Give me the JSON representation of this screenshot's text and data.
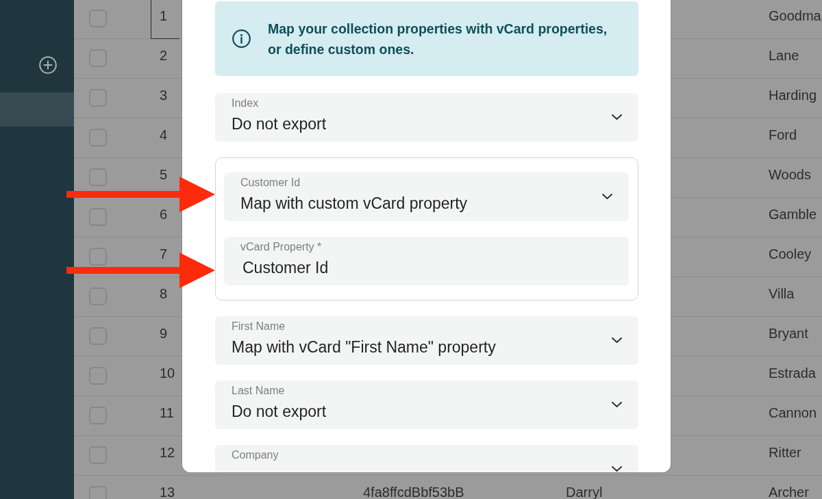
{
  "sidebar": {
    "items": [
      {
        "selected": true
      }
    ]
  },
  "table": {
    "rows": [
      {
        "checked": false,
        "focused": true,
        "number": "1",
        "column_5": "Goodma"
      },
      {
        "checked": false,
        "focused": false,
        "number": "2",
        "column_5": "Lane"
      },
      {
        "checked": false,
        "focused": false,
        "number": "3",
        "column_5": "Harding"
      },
      {
        "checked": false,
        "focused": false,
        "number": "4",
        "column_5": "Ford"
      },
      {
        "checked": false,
        "focused": false,
        "number": "5",
        "column_5": "Woods"
      },
      {
        "checked": false,
        "focused": false,
        "number": "6",
        "column_5": "Gamble"
      },
      {
        "checked": false,
        "focused": false,
        "number": "7",
        "column_5": "Cooley"
      },
      {
        "checked": false,
        "focused": false,
        "number": "8",
        "column_5": "Villa"
      },
      {
        "checked": false,
        "focused": false,
        "number": "9",
        "column_5": "Bryant"
      },
      {
        "checked": false,
        "focused": false,
        "number": "10",
        "column_5": "Estrada"
      },
      {
        "checked": false,
        "focused": false,
        "number": "11",
        "column_5": "Cannon"
      },
      {
        "checked": false,
        "focused": false,
        "number": "12",
        "column_5": "Ritter"
      },
      {
        "checked": false,
        "focused": false,
        "number": "13",
        "column_3": "4fa8ffcdBbf53bB",
        "column_4": "Darryl",
        "column_5": "Archer"
      }
    ]
  },
  "dialog": {
    "notice": {
      "text": "Map your collection properties with vCard properties, or define custom ones."
    },
    "fields": [
      {
        "kind": "select",
        "label": "Index",
        "value": "Do not export",
        "highlighted": false
      },
      {
        "kind": "group",
        "fields": [
          {
            "kind": "select",
            "label": "Customer Id",
            "value": "Map with custom vCard property",
            "highlighted": true
          },
          {
            "kind": "input",
            "label": "vCard Property *",
            "value": "Customer Id",
            "highlighted": true
          }
        ]
      },
      {
        "kind": "select",
        "label": "First Name",
        "value": "Map with vCard \"First Name\" property",
        "highlighted": false
      },
      {
        "kind": "select",
        "label": "Last Name",
        "value": "Do not export",
        "highlighted": false
      },
      {
        "kind": "select",
        "label": "Company",
        "highlighted": false
      }
    ]
  }
}
